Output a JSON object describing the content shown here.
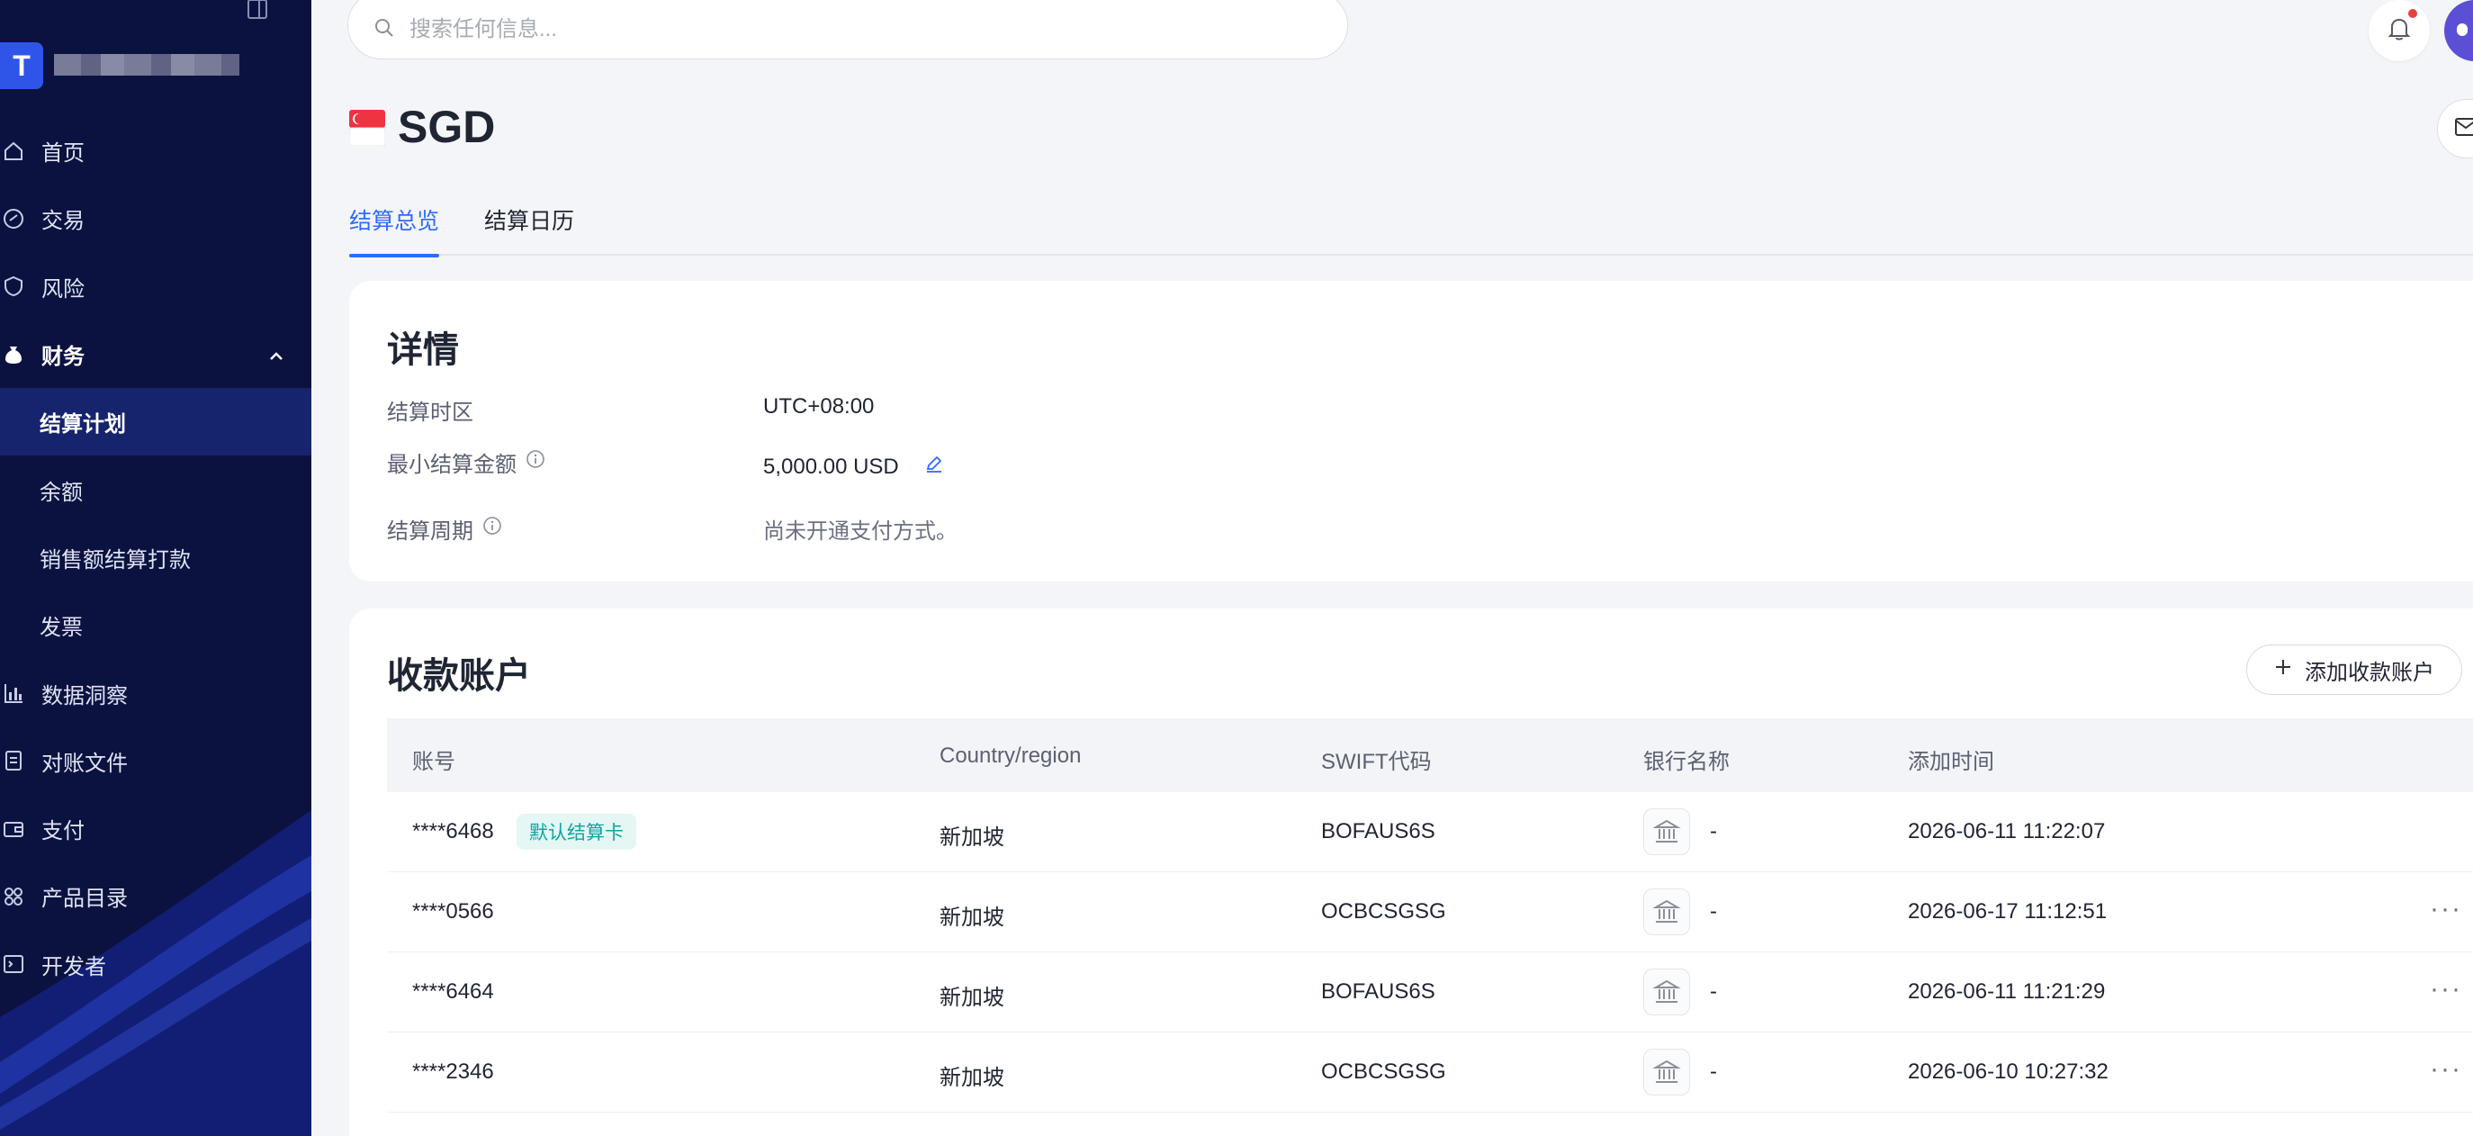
{
  "sidebar": {
    "logo_letter": "T",
    "items": [
      {
        "label": "首页",
        "icon": "home-icon"
      },
      {
        "label": "交易",
        "icon": "transaction-icon"
      },
      {
        "label": "风险",
        "icon": "shield-icon"
      },
      {
        "label": "财务",
        "icon": "money-bag-icon",
        "expanded": true
      },
      {
        "label": "结算计划",
        "sub": true,
        "active": true
      },
      {
        "label": "余额",
        "sub": true
      },
      {
        "label": "销售额结算打款",
        "sub": true
      },
      {
        "label": "发票",
        "sub": true
      },
      {
        "label": "数据洞察",
        "icon": "bar-chart-icon"
      },
      {
        "label": "对账文件",
        "icon": "document-icon"
      },
      {
        "label": "支付",
        "icon": "wallet-icon"
      },
      {
        "label": "产品目录",
        "icon": "grid-icon"
      },
      {
        "label": "开发者",
        "icon": "terminal-icon"
      }
    ]
  },
  "header": {
    "search_placeholder": "搜索任何信息..."
  },
  "page": {
    "title": "SGD",
    "flag": "singapore-flag"
  },
  "tabs": [
    {
      "label": "结算总览",
      "active": true
    },
    {
      "label": "结算日历",
      "active": false
    }
  ],
  "details": {
    "title": "详情",
    "timezone_label": "结算时区",
    "timezone_value": "UTC+08:00",
    "min_amount_label": "最小结算金额",
    "min_amount_value": "5,000.00 USD",
    "cycle_label": "结算周期",
    "cycle_value": "尚未开通支付方式。"
  },
  "accounts": {
    "title": "收款账户",
    "add_button": "添加收款账户",
    "columns": [
      "账号",
      "Country/region",
      "SWIFT代码",
      "银行名称",
      "添加时间"
    ],
    "rows": [
      {
        "account": "****6468",
        "badge": "默认结算卡",
        "country": "新加坡",
        "swift": "BOFAUS6S",
        "bank": "-",
        "added": "2026-06-11 11:22:07"
      },
      {
        "account": "****0566",
        "badge": "",
        "country": "新加坡",
        "swift": "OCBCSGSG",
        "bank": "-",
        "added": "2026-06-17 11:12:51"
      },
      {
        "account": "****6464",
        "badge": "",
        "country": "新加坡",
        "swift": "BOFAUS6S",
        "bank": "-",
        "added": "2026-06-11 11:21:29"
      },
      {
        "account": "****2346",
        "badge": "",
        "country": "新加坡",
        "swift": "OCBCSGSG",
        "bank": "-",
        "added": "2026-06-10 10:27:32"
      }
    ]
  },
  "colors": {
    "sidebar_bg": "#0c1240",
    "accent": "#2f6bff",
    "badge_text": "#0ea5a0"
  }
}
